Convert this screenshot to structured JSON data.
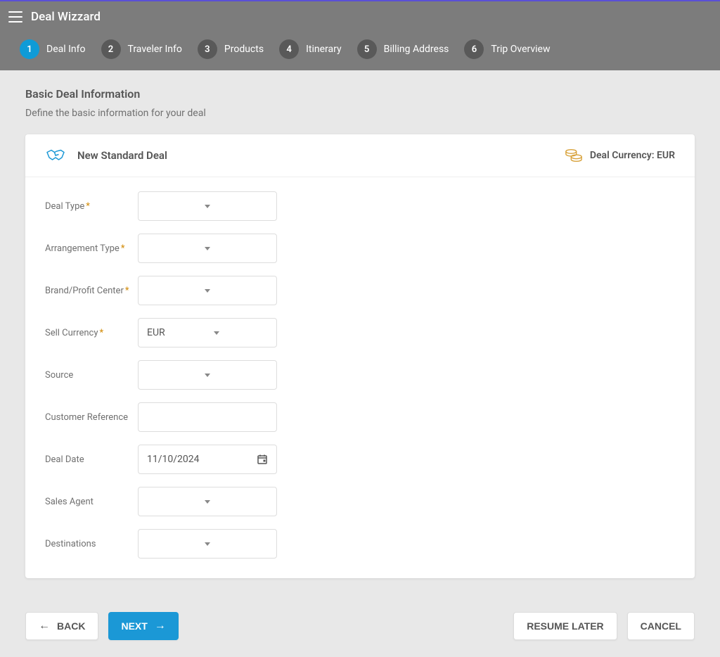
{
  "header": {
    "title": "Deal Wizzard"
  },
  "steps": [
    {
      "num": "1",
      "label": "Deal Info",
      "active": true
    },
    {
      "num": "2",
      "label": "Traveler Info",
      "active": false
    },
    {
      "num": "3",
      "label": "Products",
      "active": false
    },
    {
      "num": "4",
      "label": "Itinerary",
      "active": false
    },
    {
      "num": "5",
      "label": "Billing Address",
      "active": false
    },
    {
      "num": "6",
      "label": "Trip Overview",
      "active": false
    }
  ],
  "section": {
    "title": "Basic Deal Information",
    "description": "Define the basic information for your deal"
  },
  "card": {
    "title": "New Standard Deal",
    "currency_label": "Deal Currency: EUR"
  },
  "form": {
    "deal_type": {
      "label": "Deal Type",
      "value": "",
      "required": true
    },
    "arrangement_type": {
      "label": "Arrangement Type",
      "value": "",
      "required": true
    },
    "brand_profit_center": {
      "label": "Brand/Profit Center",
      "value": "",
      "required": true
    },
    "sell_currency": {
      "label": "Sell Currency",
      "value": "EUR",
      "required": true
    },
    "source": {
      "label": "Source",
      "value": "",
      "required": false
    },
    "customer_reference": {
      "label": "Customer Reference",
      "value": "",
      "required": false
    },
    "deal_date": {
      "label": "Deal Date",
      "value": "11/10/2024",
      "required": false
    },
    "sales_agent": {
      "label": "Sales Agent",
      "value": "",
      "required": false
    },
    "destinations": {
      "label": "Destinations",
      "value": "",
      "required": false
    }
  },
  "buttons": {
    "back": "BACK",
    "next": "NEXT",
    "resume_later": "RESUME LATER",
    "cancel": "CANCEL"
  }
}
